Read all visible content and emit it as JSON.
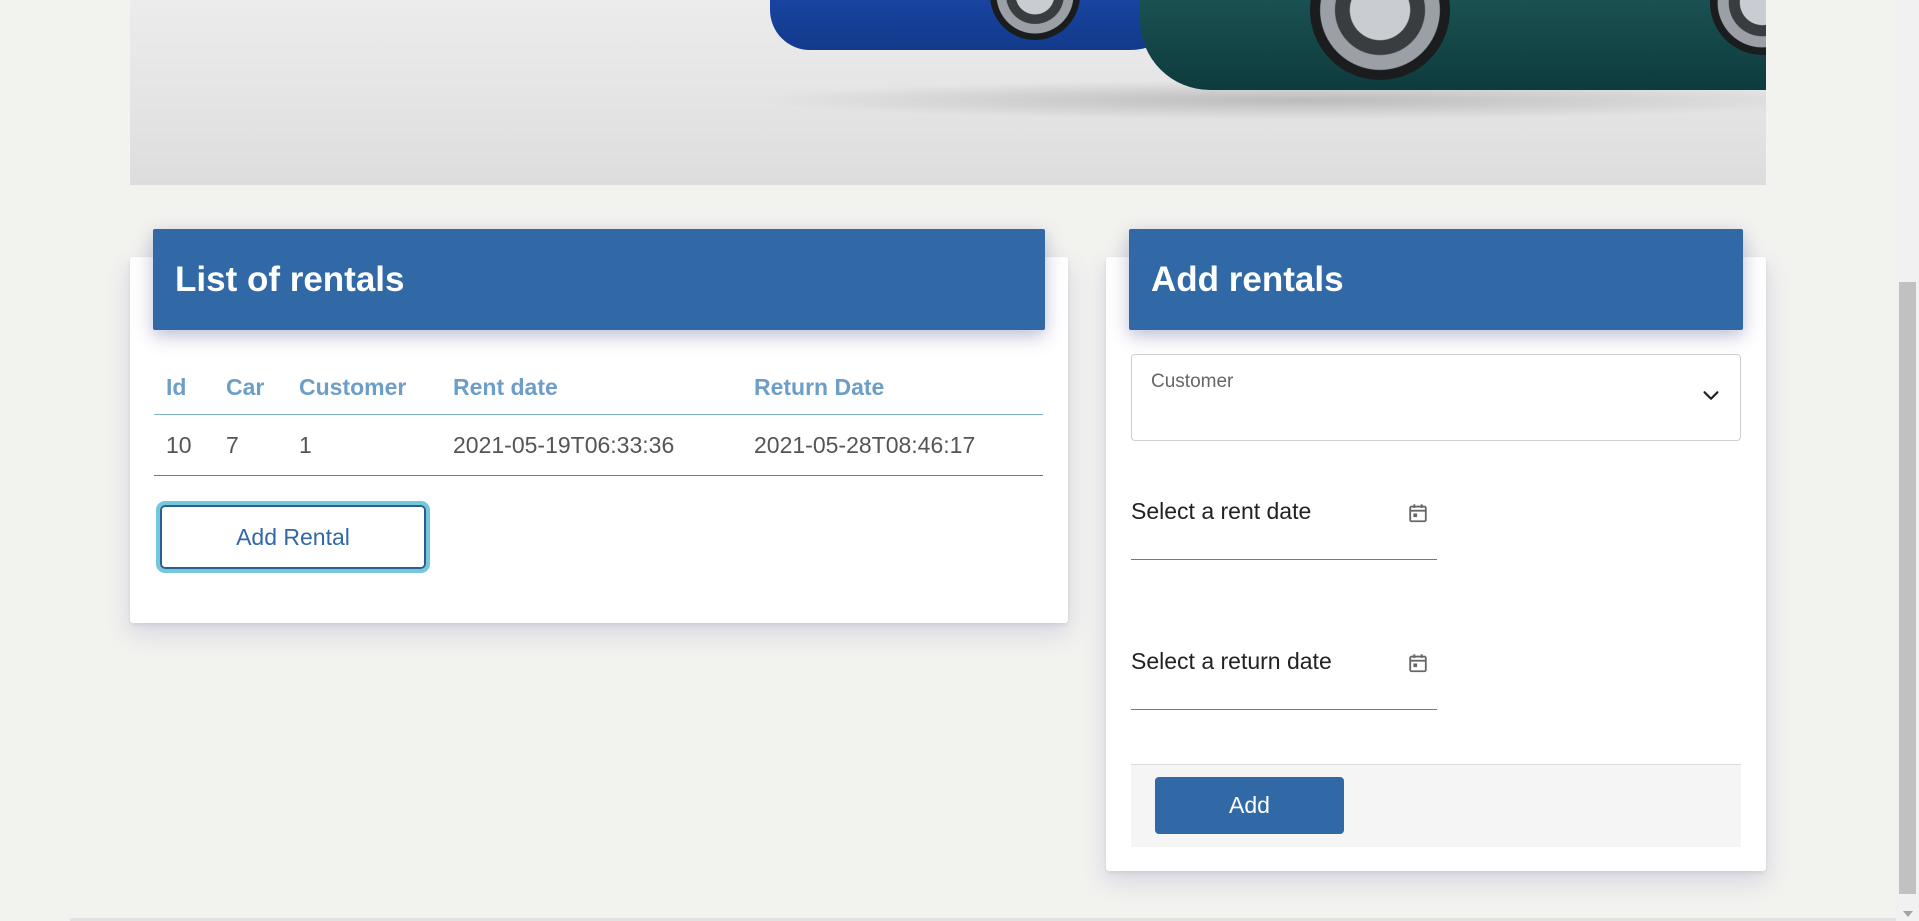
{
  "list_card": {
    "title": "List of rentals",
    "columns": [
      "Id",
      "Car",
      "Customer",
      "Rent date",
      "Return Date"
    ],
    "rows": [
      [
        "10",
        "7",
        "1",
        "2021-05-19T06:33:36",
        "2021-05-28T08:46:17"
      ]
    ],
    "add_button_label": "Add Rental"
  },
  "add_card": {
    "title": "Add rentals",
    "customer_label": "Customer",
    "rent_date_label": "Select a rent date",
    "return_date_label": "Select a return date",
    "submit_label": "Add"
  },
  "icons": {
    "customer_dropdown": "chevron-down-icon",
    "rent_date": "calendar-icon",
    "return_date": "calendar-icon"
  },
  "colors": {
    "primary": "#3169a6",
    "header_text": "#ffffff",
    "table_header_text": "#6d9ec8",
    "focus_ring": "#74c8dd",
    "page_background": "#f2f2ef"
  }
}
